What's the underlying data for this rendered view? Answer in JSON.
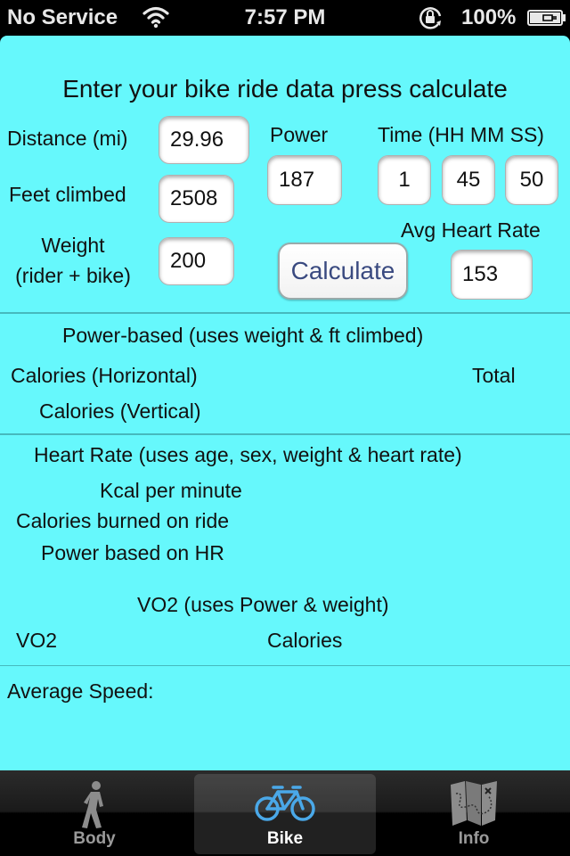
{
  "status_bar": {
    "carrier": "No Service",
    "time": "7:57 PM",
    "battery_percent": "100%",
    "icons": [
      "wifi-icon",
      "rotation-lock-icon",
      "battery-charging-icon"
    ]
  },
  "form": {
    "title": "Enter your bike ride data press calculate",
    "distance": {
      "label": "Distance (mi)",
      "value": "29.96"
    },
    "feet_climbed": {
      "label": "Feet climbed",
      "value": "2508"
    },
    "weight": {
      "label_line1": "Weight",
      "label_line2": "(rider + bike)",
      "value": "200"
    },
    "power": {
      "label": "Power",
      "value": "187"
    },
    "time": {
      "label": "Time (HH MM SS)",
      "hours": "1",
      "minutes": "45",
      "seconds": "50"
    },
    "avg_heart_rate": {
      "label": "Avg Heart Rate",
      "value": "153"
    },
    "calculate_label": "Calculate"
  },
  "results": {
    "power_based": {
      "heading": "Power-based (uses weight & ft climbed)",
      "calories_horizontal": "Calories (Horizontal)",
      "total": "Total",
      "calories_vertical": "Calories (Vertical)"
    },
    "heart_rate": {
      "heading": "Heart Rate (uses age, sex, weight & heart rate)",
      "kcal_per_minute": "Kcal per minute",
      "calories_burned": "Calories burned on ride",
      "power_based_on_hr": "Power based on HR"
    },
    "vo2": {
      "heading": "VO2 (uses Power & weight)",
      "vo2": "VO2",
      "calories": "Calories"
    },
    "average_speed": "Average Speed:"
  },
  "tab_bar": {
    "tabs": [
      {
        "label": "Body",
        "icon": "walking-person-icon",
        "active": false
      },
      {
        "label": "Bike",
        "icon": "bicycle-icon",
        "active": true
      },
      {
        "label": "Info",
        "icon": "map-icon",
        "active": false
      }
    ]
  },
  "colors": {
    "background": "#66f8fc",
    "button_text": "#3a4a80",
    "active_tab_icon": "#4aa8e8"
  }
}
